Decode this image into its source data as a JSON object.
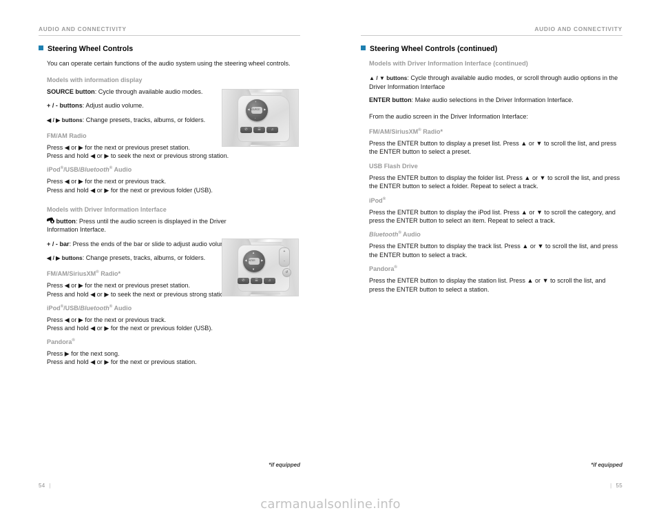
{
  "document": {
    "watermark": "carmanualsonline.info"
  },
  "left_page": {
    "running_head": "AUDIO AND CONNECTIVITY",
    "section_title": "Steering Wheel Controls",
    "intro": "You can operate certain functions of the audio system using the steering wheel controls.",
    "group1": {
      "subhead": "Models with information display",
      "items": [
        {
          "label": "SOURCE button",
          "sep": ": ",
          "text": "Cycle through available audio modes."
        },
        {
          "label": "+ / - buttons",
          "sep": ": ",
          "text": "Adjust audio volume."
        },
        {
          "label": "◀ / ▶ buttons",
          "sep": ": ",
          "text": "Change presets, tracks, albums, or folders."
        }
      ],
      "blocks": [
        {
          "subhead": "FM/AM Radio",
          "lines": [
            "Press ◀ or ▶ for the next or previous preset station.",
            "Press and hold ◀ or ▶ to seek the next or previous strong station."
          ]
        },
        {
          "subhead": "iPod®/USB/Bluetooth® Audio",
          "subhead_italic": "Bluetooth",
          "lines": [
            "Press ◀ or ▶ for the next or previous track.",
            "Press and hold ◀ or ▶ for the next or previous folder (USB)."
          ]
        }
      ]
    },
    "group2": {
      "subhead": "Models with Driver Information Interface",
      "items": [
        {
          "label": "button",
          "sep": ": ",
          "icon": "music-note-icon",
          "text": "Press until the audio screen is displayed in the Driver Information Interface."
        },
        {
          "label": "+ / - bar",
          "sep": ": ",
          "text": "Press the ends of the bar or slide to adjust audio volume."
        },
        {
          "label": "◀ / ▶ buttons",
          "sep": ": ",
          "text": "Change presets, tracks, albums, or folders."
        }
      ],
      "blocks": [
        {
          "subhead": "FM/AM/SiriusXM® Radio*",
          "lines": [
            "Press ◀ or ▶ for the next or previous preset station.",
            "Press and hold ◀ or ▶ to seek the next or previous strong station."
          ]
        },
        {
          "subhead": "iPod®/USB/Bluetooth® Audio",
          "lines": [
            "Press ◀ or ▶ for the next or previous track.",
            "Press and hold ◀ or ▶ for the next or previous folder (USB)."
          ]
        },
        {
          "subhead": "Pandora®",
          "lines": [
            "Press ▶ for the next song.",
            "Press and hold ◀ or ▶ for the next or previous station."
          ]
        }
      ]
    },
    "footnote": "*if equipped",
    "page_number": "54"
  },
  "right_page": {
    "running_head": "AUDIO AND CONNECTIVITY",
    "section_title": "Steering Wheel Controls (continued)",
    "subhead": "Models with Driver Information Interface (continued)",
    "items": [
      {
        "label": "▲ / ▼ buttons",
        "sep": ": ",
        "text": "Cycle through available audio modes, or scroll through audio options in the Driver Information Interface"
      },
      {
        "label": "ENTER button",
        "sep": ": ",
        "text": "Make audio selections in the Driver Information Interface."
      }
    ],
    "lead_in": "From the audio screen in the Driver Information Interface:",
    "blocks": [
      {
        "subhead": "FM/AM/SiriusXM® Radio*",
        "text": "Press the ENTER button to display a preset list. Press ▲ or ▼ to scroll the list, and press the ENTER button to select a preset."
      },
      {
        "subhead": "USB Flash Drive",
        "text": "Press the ENTER button to display the folder list. Press ▲ or ▼ to scroll the list, and press the ENTER button to select a folder. Repeat to select a track."
      },
      {
        "subhead": "iPod®",
        "text": "Press the ENTER button to display the iPod list. Press ▲ or ▼ to scroll the category, and press the ENTER button to select an item. Repeat to select a track."
      },
      {
        "subhead": "Bluetooth® Audio",
        "text": "Press the ENTER button to display the track list. Press ▲ or ▼ to scroll the list, and press the ENTER button to select a track."
      },
      {
        "subhead": "Pandora®",
        "text": "Press the ENTER button to display the station list. Press ▲ or ▼ to scroll the list, and press the ENTER button to select a station."
      }
    ],
    "footnote": "*if equipped",
    "page_number": "55"
  },
  "images": {
    "wheel1": {
      "name": "steering-wheel-info-display-photo",
      "center_label": "SOURCE",
      "keys": [
        "+",
        "-",
        "◀",
        "▶"
      ],
      "lower_buttons": [
        "✆",
        "☰",
        "♫"
      ]
    },
    "wheel2": {
      "name": "steering-wheel-dii-photo",
      "center_label": "ENTER",
      "keys": [
        "▲",
        "▼",
        "◀",
        "▶"
      ],
      "bar_labels": [
        "+",
        "-"
      ],
      "lower_buttons": [
        "✆",
        "☰",
        "♫"
      ]
    }
  },
  "colors": {
    "accent": "#1d7fb0",
    "subhead_gray": "#9b9b9b",
    "rule_gray": "#c9c9c9"
  }
}
